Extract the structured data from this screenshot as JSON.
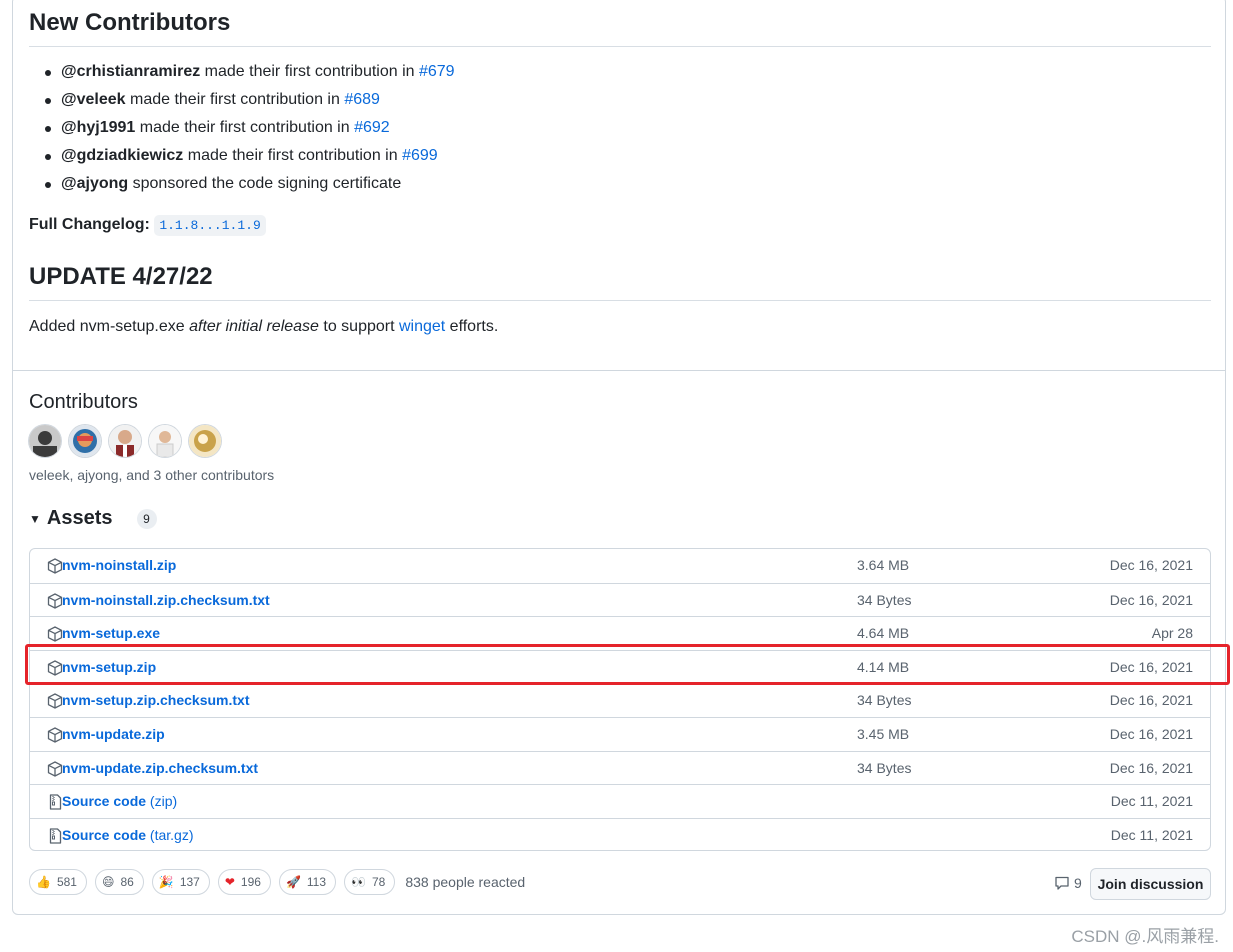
{
  "new_contributors": {
    "title": "New Contributors",
    "items": [
      {
        "user": "@crhistianramirez",
        "text": " made their first contribution in ",
        "pr": "#679"
      },
      {
        "user": "@veleek",
        "text": " made their first contribution in ",
        "pr": "#689"
      },
      {
        "user": "@hyj1991",
        "text": " made their first contribution in ",
        "pr": "#692"
      },
      {
        "user": "@gdziadkiewicz",
        "text": " made their first contribution in ",
        "pr": "#699"
      },
      {
        "user": "@ajyong",
        "text": " sponsored the code signing certificate",
        "pr": ""
      }
    ]
  },
  "changelog": {
    "label": "Full Changelog:",
    "range": "1.1.8...1.1.9"
  },
  "update": {
    "title": "UPDATE 4/27/22",
    "text1": "Added nvm-setup.exe ",
    "emphasis": "after initial release",
    "text2": " to support ",
    "link": "winget",
    "text3": " efforts."
  },
  "contributors": {
    "title": "Contributors",
    "summary": "veleek, ajyong, and 3 other contributors",
    "avatar_colors": [
      "#3b3b3b",
      "#2f6fa8",
      "#8b2a2a",
      "#e9e9e9",
      "#c9a24a"
    ]
  },
  "assets": {
    "title": "Assets",
    "count": "9",
    "rows": [
      {
        "name": "nvm-noinstall.zip",
        "suffix": "",
        "size": "3.64 MB",
        "date": "Dec 16, 2021",
        "icon": "package-icon"
      },
      {
        "name": "nvm-noinstall.zip.checksum.txt",
        "suffix": "",
        "size": "34 Bytes",
        "date": "Dec 16, 2021",
        "icon": "package-icon"
      },
      {
        "name": "nvm-setup.exe",
        "suffix": "",
        "size": "4.64 MB",
        "date": "Apr 28",
        "icon": "package-icon"
      },
      {
        "name": "nvm-setup.zip",
        "suffix": "",
        "size": "4.14 MB",
        "date": "Dec 16, 2021",
        "icon": "package-icon"
      },
      {
        "name": "nvm-setup.zip.checksum.txt",
        "suffix": "",
        "size": "34 Bytes",
        "date": "Dec 16, 2021",
        "icon": "package-icon"
      },
      {
        "name": "nvm-update.zip",
        "suffix": "",
        "size": "3.45 MB",
        "date": "Dec 16, 2021",
        "icon": "package-icon"
      },
      {
        "name": "nvm-update.zip.checksum.txt",
        "suffix": "",
        "size": "34 Bytes",
        "date": "Dec 16, 2021",
        "icon": "package-icon"
      },
      {
        "name": "Source code",
        "suffix": " (zip)",
        "size": "",
        "date": "Dec 11, 2021",
        "icon": "file-zip-icon"
      },
      {
        "name": "Source code",
        "suffix": " (tar.gz)",
        "size": "",
        "date": "Dec 11, 2021",
        "icon": "file-zip-icon"
      }
    ]
  },
  "reactions": {
    "items": [
      {
        "emoji": "👍",
        "count": "581",
        "name": "thumbs-up"
      },
      {
        "emoji": "😄",
        "count": "86",
        "name": "laugh"
      },
      {
        "emoji": "🎉",
        "count": "137",
        "name": "hooray"
      },
      {
        "emoji": "❤",
        "count": "196",
        "name": "heart"
      },
      {
        "emoji": "🚀",
        "count": "113",
        "name": "rocket"
      },
      {
        "emoji": "👀",
        "count": "78",
        "name": "eyes"
      }
    ],
    "summary": "838 people reacted"
  },
  "discussion": {
    "comments": "9",
    "join_label": "Join discussion"
  },
  "watermark": "CSDN @.风雨兼程."
}
